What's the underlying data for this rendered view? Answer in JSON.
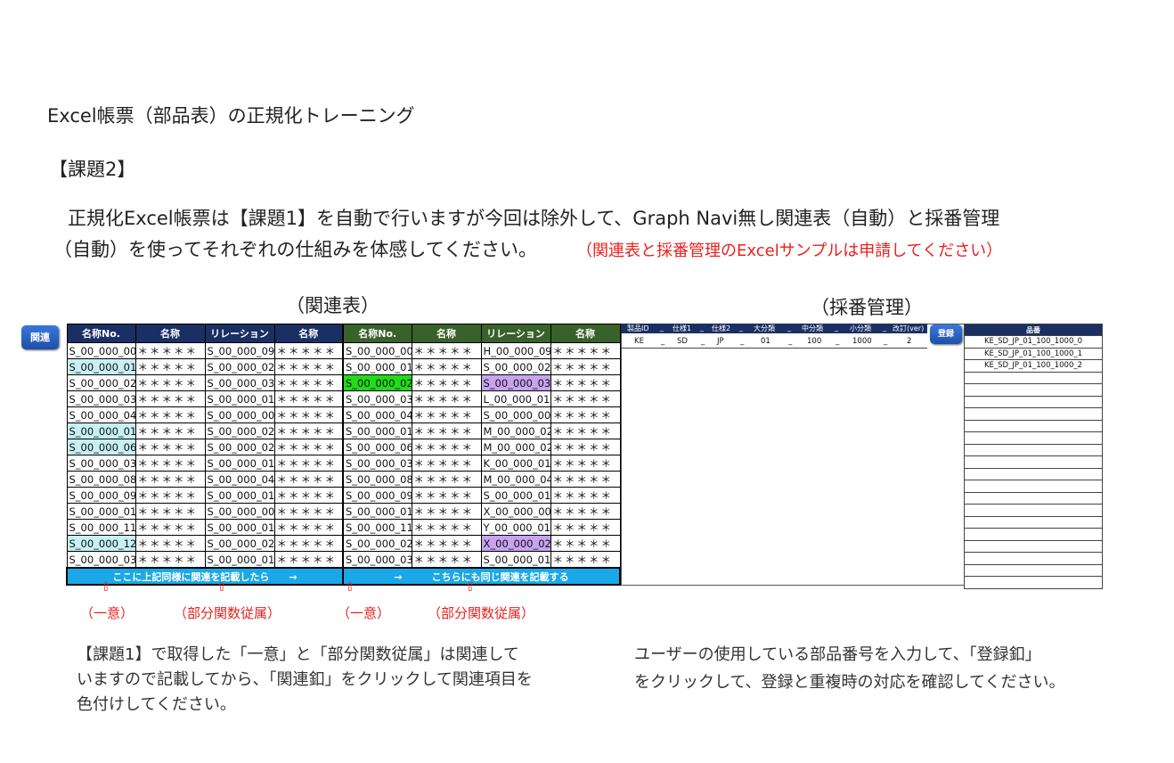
{
  "page": {
    "title": "Excel帳票（部品表）の正規化トレーニング",
    "heading": "【課題2】",
    "para_line1": "正規化Excel帳票は【課題1】を自動で行いますが今回は除外して、Graph Navi無し関連表（自動）と採番管理",
    "para_line2": "（自動）を使ってそれぞれの仕組みを体感してください。",
    "para_note": "（関連表と採番管理のExcelサンプルは申請してください）"
  },
  "relation": {
    "section_label": "（関連表）",
    "button_label": "関連",
    "headers": [
      "名称No.",
      "名称",
      "リレーション",
      "名称",
      "名称No.",
      "名称",
      "リレーション",
      "名称"
    ],
    "rows": [
      [
        "S_00_000_00",
        "＊＊＊＊＊",
        "S_00_000_09",
        "＊＊＊＊＊",
        "S_00_000_00",
        "＊＊＊＊＊",
        "H_00_000_09",
        "＊＊＊＊＊"
      ],
      [
        "S_00_000_01",
        "＊＊＊＊＊",
        "S_00_000_02",
        "＊＊＊＊＊",
        "S_00_000_01",
        "＊＊＊＊＊",
        "S_00_000_02",
        "＊＊＊＊＊"
      ],
      [
        "S_00_000_02",
        "＊＊＊＊＊",
        "S_00_000_03",
        "＊＊＊＊＊",
        "S_00_000_02",
        "＊＊＊＊＊",
        "S_00_000_03",
        "＊＊＊＊＊"
      ],
      [
        "S_00_000_03",
        "＊＊＊＊＊",
        "S_00_000_01",
        "＊＊＊＊＊",
        "S_00_000_03",
        "＊＊＊＊＊",
        "L_00_000_01",
        "＊＊＊＊＊"
      ],
      [
        "S_00_000_04",
        "＊＊＊＊＊",
        "S_00_000_00",
        "＊＊＊＊＊",
        "S_00_000_04",
        "＊＊＊＊＊",
        "S_00_000_00",
        "＊＊＊＊＊"
      ],
      [
        "S_00_000_01",
        "＊＊＊＊＊",
        "S_00_000_02",
        "＊＊＊＊＊",
        "S_00_000_01",
        "＊＊＊＊＊",
        "M_00_000_02",
        "＊＊＊＊＊"
      ],
      [
        "S_00_000_06",
        "＊＊＊＊＊",
        "S_00_000_02",
        "＊＊＊＊＊",
        "S_00_000_06",
        "＊＊＊＊＊",
        "M_00_000_02",
        "＊＊＊＊＊"
      ],
      [
        "S_00_000_03",
        "＊＊＊＊＊",
        "S_00_000_01",
        "＊＊＊＊＊",
        "S_00_000_03",
        "＊＊＊＊＊",
        "K_00_000_01",
        "＊＊＊＊＊"
      ],
      [
        "S_00_000_08",
        "＊＊＊＊＊",
        "S_00_000_04",
        "＊＊＊＊＊",
        "S_00_000_08",
        "＊＊＊＊＊",
        "M_00_000_04",
        "＊＊＊＊＊"
      ],
      [
        "S_00_000_09",
        "＊＊＊＊＊",
        "S_00_000_01",
        "＊＊＊＊＊",
        "S_00_000_09",
        "＊＊＊＊＊",
        "S_00_000_01",
        "＊＊＊＊＊"
      ],
      [
        "S_00_000_01",
        "＊＊＊＊＊",
        "S_00_000_00",
        "＊＊＊＊＊",
        "S_00_000_01",
        "＊＊＊＊＊",
        "X_00_000_00",
        "＊＊＊＊＊"
      ],
      [
        "S_00_000_11",
        "＊＊＊＊＊",
        "S_00_000_01",
        "＊＊＊＊＊",
        "S_00_000_11",
        "＊＊＊＊＊",
        "Y_00_000_01",
        "＊＊＊＊＊"
      ],
      [
        "S_00_000_12",
        "＊＊＊＊＊",
        "S_00_000_02",
        "＊＊＊＊＊",
        "S_00_000_02",
        "＊＊＊＊＊",
        "X_00_000_02",
        "＊＊＊＊＊"
      ],
      [
        "S_00_000_03",
        "＊＊＊＊＊",
        "S_00_000_01",
        "＊＊＊＊＊",
        "S_00_000_03",
        "＊＊＊＊＊",
        "S_00_000_01",
        "＊＊＊＊＊"
      ]
    ],
    "highlights": {
      "cyan": [
        [
          1,
          0
        ],
        [
          5,
          0
        ],
        [
          6,
          0
        ],
        [
          12,
          0
        ]
      ],
      "green": [
        [
          2,
          4
        ]
      ],
      "purple": [
        [
          2,
          6
        ],
        [
          12,
          6
        ]
      ]
    },
    "footer_left": "ここに上記同様に関連を記載したら　　→",
    "footer_right": "→　　　こちらにも同じ関連を記載する",
    "colors": {
      "header_left": "#1a2f63",
      "header_right": "#39612b",
      "footer": "#1aa8e8",
      "cyan": "#c7f0f3",
      "green": "#21dc19",
      "purple": "#c7a4ef",
      "red": "#e8201e"
    }
  },
  "annotations": {
    "ichii": "（一意）",
    "bubun": "（部分関数従属）",
    "marker": "⇧"
  },
  "numbering": {
    "section_label": "（採番管理）",
    "button_label": "登録",
    "headers": [
      "製品ID",
      "_",
      "仕様1",
      "_",
      "仕様2",
      "_",
      "大分類",
      "_",
      "中分類",
      "_",
      "小分類",
      "_",
      "改訂(ver)"
    ],
    "values": [
      "KE",
      "_",
      "SD",
      "_",
      "JP",
      "_",
      "01",
      "_",
      "100",
      "_",
      "1000",
      "_",
      "2"
    ],
    "hinban_header": "品番",
    "hinban_rows": [
      "KE_SD_JP_01_100_1000_0",
      "KE_SD_JP_01_100_1000_1",
      "KE_SD_JP_01_100_1000_2",
      "",
      "",
      "",
      "",
      "",
      "",
      "",
      "",
      "",
      "",
      "",
      "",
      "",
      "",
      "",
      "",
      "",
      ""
    ]
  },
  "instructions": {
    "left_line1": "【課題1】で取得した「一意」と「部分関数従属」は関連して",
    "left_line2": "いますので記載してから、「関連釦」をクリックして関連項目を",
    "left_line3": "色付けしてください。",
    "right_line1": "ユーザーの使用している部品番号を入力して、「登録釦」",
    "right_line2": "をクリックして、登録と重複時の対応を確認してください。"
  }
}
